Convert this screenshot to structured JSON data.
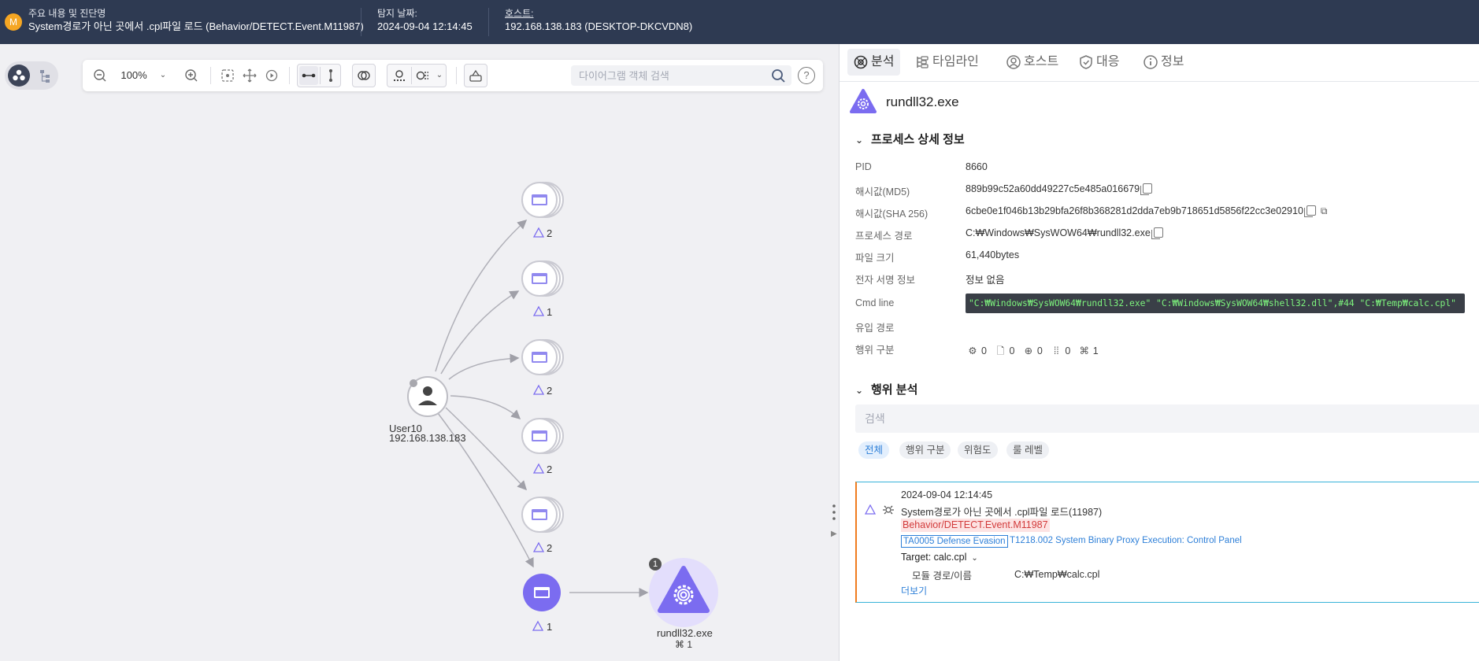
{
  "header": {
    "badge": "M",
    "detection_label": "주요 내용 및 진단명",
    "detection_value": "System경로가 아닌 곳에서 .cpl파일 로드 (Behavior/DETECT.Event.M11987)",
    "date_label": "탐지 날짜:",
    "date_value": "2024-09-04 12:14:45",
    "host_label": "호스트:",
    "host_value": "192.168.138.183 (DESKTOP-DKCVDN8)"
  },
  "toolbar": {
    "zoom": "100%",
    "search_placeholder": "다이어그램 객체 검색",
    "help": "?"
  },
  "graph": {
    "user_name": "User10",
    "user_ip": "192.168.138.183",
    "node_counts": [
      "2",
      "1",
      "2",
      "2",
      "2"
    ],
    "selected_node_count": "1",
    "process_name": "rundll32.exe",
    "process_badge": "1",
    "process_sub_count": "1",
    "accent_color": "#7b6cf0"
  },
  "tabs": [
    {
      "label": "분석",
      "icon": "analysis-icon",
      "active": true
    },
    {
      "label": "타임라인",
      "icon": "timeline-icon",
      "active": false
    },
    {
      "label": "호스트",
      "icon": "host-icon",
      "active": false
    },
    {
      "label": "대응",
      "icon": "shield-icon",
      "active": false
    },
    {
      "label": "정보",
      "icon": "info-icon",
      "active": false
    }
  ],
  "process": {
    "name": "rundll32.exe",
    "section_title": "프로세스 상세 정보",
    "fields": {
      "pid_label": "PID",
      "pid_value": "8660",
      "md5_label": "해시값(MD5)",
      "md5_value": "889b99c52a60dd49227c5e485a016679",
      "sha_label": "해시값(SHA 256)",
      "sha_value": "6cbe0e1f046b13b29bfa26f8b368281d2dda7eb9b718651d5856f22cc3e02910",
      "path_label": "프로세스 경로",
      "path_value": "C:₩Windows₩SysWOW64₩rundll32.exe",
      "size_label": "파일 크기",
      "size_value": "61,440bytes",
      "sign_label": "전자 서명 정보",
      "sign_value": "정보 없음",
      "cmd_label": "Cmd line",
      "cmd_value": "\"C:₩Windows₩SysWOW64₩rundll32.exe\" \"C:₩Windows₩SysWOW64₩shell32.dll\",#44 \"C:₩Temp₩calc.cpl\"",
      "origin_label": "유입 경로",
      "origin_value": "",
      "behavior_label": "행위 구분"
    },
    "behavior_counts": [
      "0",
      "0",
      "0",
      "0",
      "1"
    ]
  },
  "analysis": {
    "section_title": "행위 분석",
    "search_placeholder": "검색",
    "chips": [
      "전체",
      "행위 구분",
      "위험도",
      "룰 레벨"
    ],
    "event": {
      "time": "2024-09-04 12:14:45",
      "title": "System경로가 아닌 곳에서 .cpl파일 로드(11987)",
      "rule": "Behavior/DETECT.Event.M11987",
      "tactic": "TA0005 Defense Evasion",
      "technique": "T1218.002 System Binary Proxy Execution: Control Panel",
      "target": "Target: calc.cpl",
      "module_label": "모듈 경로/이름",
      "module_value": "C:₩Temp₩calc.cpl",
      "more": "더보기"
    }
  }
}
